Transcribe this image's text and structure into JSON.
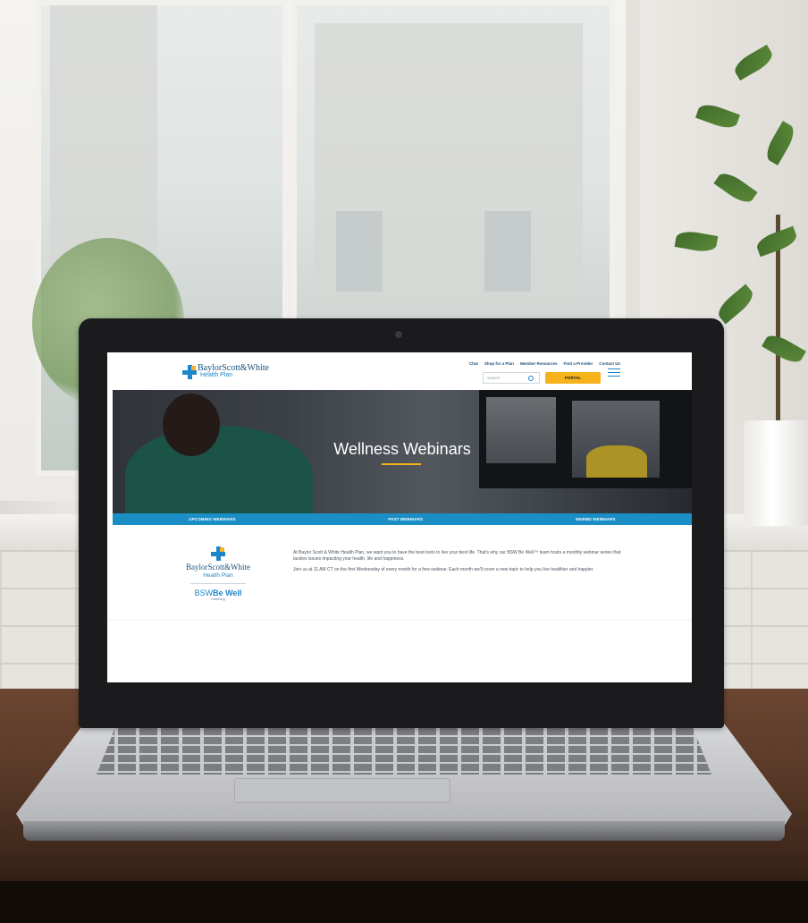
{
  "site": {
    "logo": {
      "line1": "BaylorScott&White",
      "line2": "Health Plan"
    },
    "nav_links": [
      "Chat",
      "Shop for a Plan",
      "Member Resources",
      "Find a Provider",
      "Contact Us"
    ],
    "search_placeholder": "Search",
    "portal_label": "PORTAL"
  },
  "hero": {
    "title": "Wellness Webinars"
  },
  "tabs": [
    "UPCOMING WEBINARS",
    "PAST WEBINARS",
    "WEBMD WEBINARS"
  ],
  "content": {
    "logo_line1": "BaylorScott&White",
    "logo_line2": "Health Plan",
    "bewell_prefix": "BSW",
    "bewell_name": "Be Well",
    "bewell_sub": "coaching",
    "paragraphs": [
      "At Baylor Scott & White Health Plan, we want you to have the best tools to live your best life. That's why our BSW Be Well™ team hosts a monthly webinar series that tackles issues impacting your health, life and happiness.",
      "Join us at 11 AM CT on the first Wednesday of every month for a free webinar. Each month we'll cover a new topic to help you live healthier and happier."
    ]
  },
  "colors": {
    "brand_blue": "#1d86c8",
    "brand_navy": "#1a4f7a",
    "accent_yellow": "#f6b21b",
    "tab_bar": "#1b8ec6"
  }
}
